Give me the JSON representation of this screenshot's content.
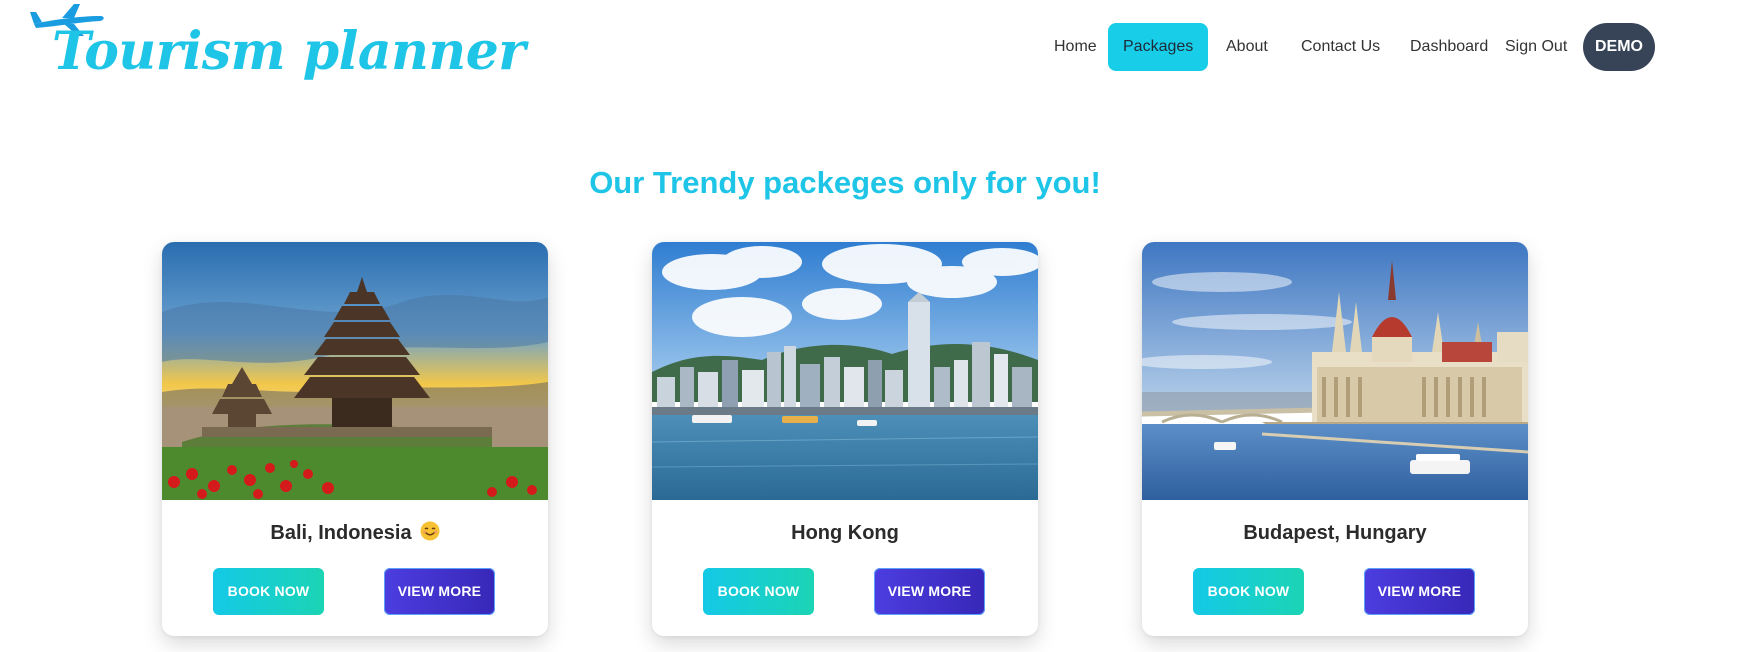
{
  "brand": {
    "name": "Tourism planner",
    "icon": "airplane-icon",
    "color": "#1ec5e6"
  },
  "nav": {
    "items": [
      {
        "label": "Home",
        "active": false
      },
      {
        "label": "Packages",
        "active": true
      },
      {
        "label": "About",
        "active": false
      },
      {
        "label": "Contact Us",
        "active": false
      },
      {
        "label": "Dashboard",
        "active": false
      },
      {
        "label": "Sign Out",
        "active": false
      }
    ],
    "user_button": "DEMO"
  },
  "section": {
    "title": "Our Trendy packeges only for you!"
  },
  "packages": [
    {
      "title": "Bali, Indonesia",
      "emoji": "smiling-face-emoji",
      "book_label": "BOOK NOW",
      "view_label": "VIEW MORE",
      "image": "bali-temple-photo"
    },
    {
      "title": "Hong Kong",
      "book_label": "BOOK NOW",
      "view_label": "VIEW MORE",
      "image": "hong-kong-skyline-photo"
    },
    {
      "title": "Budapest, Hungary",
      "book_label": "BOOK NOW",
      "view_label": "VIEW MORE",
      "image": "budapest-parliament-photo"
    }
  ],
  "colors": {
    "accent": "#17cde7",
    "demo_bg": "#374357",
    "book_gradient": [
      "#14c9e6",
      "#1bd4b4"
    ],
    "view_gradient": [
      "#4c3de0",
      "#3728b8"
    ]
  }
}
